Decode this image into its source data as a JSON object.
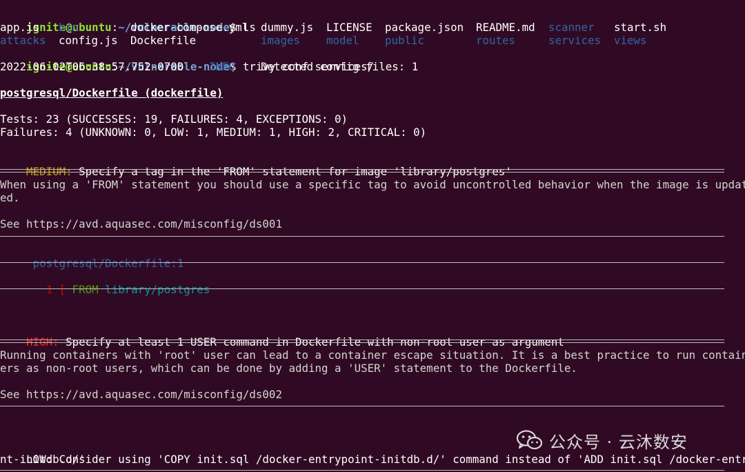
{
  "prompt": {
    "user_host": "ignite@ubuntu",
    "path": "~/vulnerable-node",
    "sep": ":",
    "dollar": "$"
  },
  "commands": {
    "ls": " ls",
    "trivy": " trivy conf services/"
  },
  "ls_output": {
    "row1": [
      "app.js",
      "bin",
      "docker-compose.yml",
      "dummy.js",
      "LICENSE",
      "package.json",
      "README.md",
      "scanner",
      "start.sh"
    ],
    "row2": [
      "attacks",
      "config.js",
      "Dockerfile",
      "images",
      "model",
      "public",
      "routes",
      "services",
      "views"
    ]
  },
  "log": {
    "timestamp": "2022-06-02T06:38:57.752-0700",
    "level": "INFO",
    "message": "Detected config files: 1"
  },
  "report": {
    "target": "postgresql/Dockerfile (dockerfile)",
    "tests": "Tests: 23 (SUCCESSES: 19, FAILURES: 4, EXCEPTIONS: 0)",
    "failures": "Failures: 4 (UNKNOWN: 0, LOW: 1, MEDIUM: 1, HIGH: 2, CRITICAL: 0)"
  },
  "findings": {
    "medium": {
      "severity": "MEDIUM:",
      "title": " Specify a tag in the 'FROM' statement for image 'library/postgres'",
      "desc1": "When using a 'FROM' statement you should use a specific tag to avoid uncontrolled behavior when the image is updat",
      "desc2": "ed.",
      "link": "See https://avd.aquasec.com/misconfig/ds001",
      "location": " postgresql/Dockerfile",
      "location_line": ":1",
      "code_num": "   1 [ ",
      "code_kw": "FROM",
      "code_arg": " library/postgres"
    },
    "high": {
      "severity": "HIGH:",
      "title": " Specify at least 1 USER command in Dockerfile with non-root user as argument",
      "desc1": "Running containers with 'root' user can lead to a container escape situation. It is a best practice to run contain",
      "desc2": "ers as non-root users, which can be done by adding a 'USER' statement to the Dockerfile.",
      "link": "See https://avd.aquasec.com/misconfig/ds002"
    },
    "low": {
      "severity": "LOW:",
      "title": " Consider using 'COPY init.sql /docker-entrypoint-initdb.d/' command instead of 'ADD init.sql /docker-entrypoi",
      "title2": "nt-initdb.d/'"
    }
  },
  "watermark": {
    "text": "公众号 · 云沐数安"
  },
  "colors": {
    "background": "#300a24",
    "prompt_user": "#8ae234",
    "prompt_path": "#729fcf",
    "directory": "#3465a4",
    "medium": "#c4a000",
    "high": "#ef2929"
  }
}
